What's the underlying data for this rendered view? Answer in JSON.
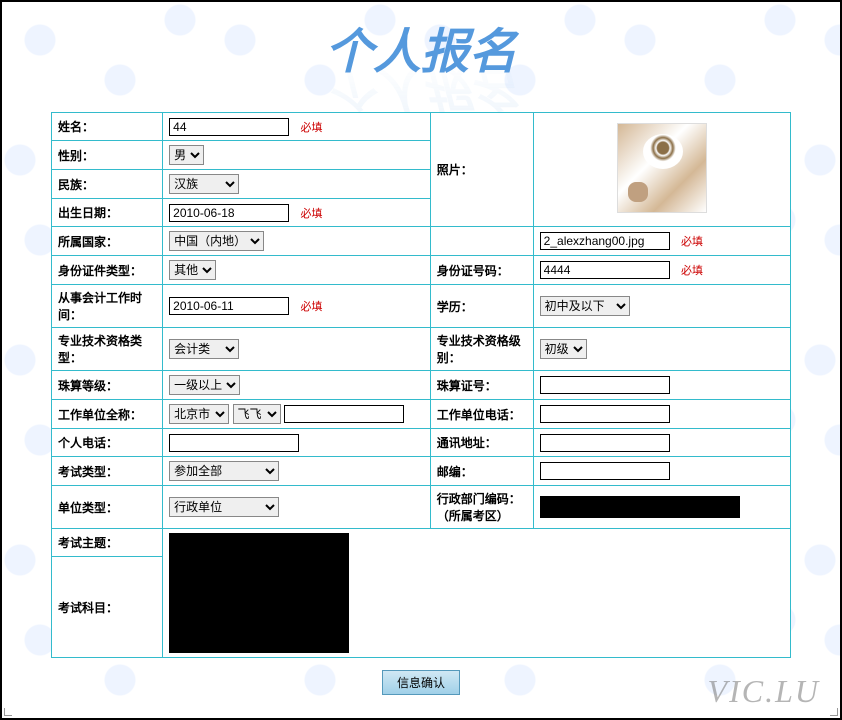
{
  "title": "个人报名",
  "required_label": "必填",
  "fields": {
    "name_label": "姓名：",
    "name_value": "44",
    "gender_label": "性别：",
    "gender_value": "男",
    "ethnicity_label": "民族：",
    "ethnicity_value": "汉族",
    "birthdate_label": "出生日期：",
    "birthdate_value": "2010-06-18",
    "country_label": "所属国家：",
    "country_value": "中国（内地）",
    "photo_label": "照片：",
    "photo_filename": "2_alexzhang00.jpg",
    "idtype_label": "身份证件类型：",
    "idtype_value": "其他",
    "idnum_label": "身份证号码：",
    "idnum_value": "4444",
    "worktime_label": "从事会计工作时间：",
    "worktime_value": "2010-06-11",
    "edu_label": "学历：",
    "edu_value": "初中及以下",
    "qualtype_label": "专业技术资格类型：",
    "qualtype_value": "会计类",
    "quallevel_label": "专业技术资格级别：",
    "quallevel_value": "初级",
    "abacuslevel_label": "珠算等级：",
    "abacuslevel_value": "一级以上",
    "abacusnum_label": "珠算证号：",
    "abacusnum_value": "",
    "workunit_label": "工作单位全称：",
    "workunit_city": "北京市",
    "workunit_district": "飞飞",
    "workunit_name": "",
    "workphone_label": "工作单位电话：",
    "workphone_value": "",
    "phone_label": "个人电话：",
    "phone_value": "",
    "address_label": "通讯地址：",
    "address_value": "",
    "examtype_label": "考试类型：",
    "examtype_value": "参加全部",
    "postal_label": "邮编：",
    "postal_value": "",
    "unittype_label": "单位类型：",
    "unittype_value": "行政单位",
    "deptcode_label1": "行政部门编码：",
    "deptcode_label2": "（所属考区）",
    "examtopic_label": "考试主题：",
    "examsubject_label": "考试科目："
  },
  "submit_label": "信息确认",
  "watermark": "VIC.LU"
}
